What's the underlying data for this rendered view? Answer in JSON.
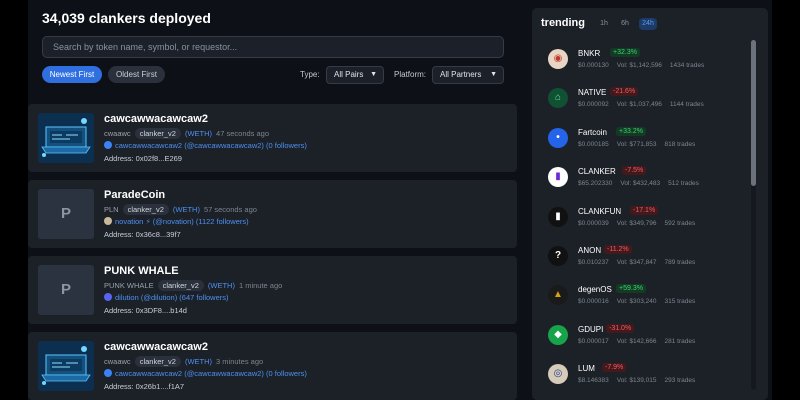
{
  "header": {
    "title": "34,039 clankers deployed"
  },
  "search": {
    "placeholder": "Search by token name, symbol, or requestor..."
  },
  "sort": {
    "newest": "Newest First",
    "oldest": "Oldest First"
  },
  "filters": {
    "type_label": "Type:",
    "type_value": "All Pairs",
    "platform_label": "Platform:",
    "platform_value": "All Partners"
  },
  "tokens": [
    {
      "name": "cawcawwacawcaw2",
      "symbol": "cwaawc",
      "badge": "clanker_v2",
      "pair": "(WETH)",
      "time": "47 seconds ago",
      "requestor": "cawcawwacawcaw2 (@cawcawwacawcaw2) (0 followers)",
      "address": "Address: 0x02f8...E269",
      "thumb": "art"
    },
    {
      "name": "ParadeCoin",
      "symbol": "PLN",
      "badge": "clanker_v2",
      "pair": "(WETH)",
      "time": "57 seconds ago",
      "requestor": "novation ⚡ (@novation) (1122 followers)",
      "address": "Address: 0x36c8...39f7",
      "thumb": "placeholder",
      "letter": "P"
    },
    {
      "name": "PUNK WHALE",
      "symbol": "PUNK WHALE",
      "badge": "clanker_v2",
      "pair": "(WETH)",
      "time": "1 minute ago",
      "requestor": "dilution (@dilution) (647 followers)",
      "address": "Address: 0x3DF8....b14d",
      "thumb": "placeholder",
      "letter": "P"
    },
    {
      "name": "cawcawwacawcaw2",
      "symbol": "cwaawc",
      "badge": "clanker_v2",
      "pair": "(WETH)",
      "time": "3 minutes ago",
      "requestor": "cawcawwacawcaw2 (@cawcawwacawcaw2) (0 followers)",
      "address": "Address: 0x26b1....f1A7",
      "thumb": "art"
    }
  ],
  "trending": {
    "title": "trending",
    "tabs": [
      "1h",
      "6h",
      "24h"
    ],
    "active_tab": "24h",
    "items": [
      {
        "name": "BNKR",
        "change": "+32.3%",
        "dir": "up",
        "price": "$0.000130",
        "vol": "Vol: $1,142,596",
        "trades": "1434 trades",
        "icon_bg": "#e8d5c4",
        "icon_fg": "#c0392b",
        "glyph": "◉"
      },
      {
        "name": "NATIVE",
        "change": "-21.6%",
        "dir": "down",
        "price": "$0.000092",
        "vol": "Vol: $1,037,496",
        "trades": "1144 trades",
        "icon_bg": "#0f5132",
        "icon_fg": "#6ee7a8",
        "glyph": "⌂"
      },
      {
        "name": "Fartcoin",
        "change": "+33.2%",
        "dir": "up",
        "price": "$0.000185",
        "vol": "Vol: $771,853",
        "trades": "818 trades",
        "icon_bg": "#2563eb",
        "icon_fg": "#ffffff",
        "glyph": "•"
      },
      {
        "name": "CLANKER",
        "change": "-7.5%",
        "dir": "down",
        "price": "$65.202330",
        "vol": "Vol: $432,483",
        "trades": "512 trades",
        "icon_bg": "#ffffff",
        "icon_fg": "#6d28d9",
        "glyph": "▮"
      },
      {
        "name": "CLANKFUN",
        "change": "-17.1%",
        "dir": "down",
        "price": "$0.000039",
        "vol": "Vol: $349,796",
        "trades": "592 trades",
        "icon_bg": "#111111",
        "icon_fg": "#ffffff",
        "glyph": "▮"
      },
      {
        "name": "ANON",
        "change": "-11.2%",
        "dir": "down",
        "price": "$0.010237",
        "vol": "Vol: $347,847",
        "trades": "789 trades",
        "icon_bg": "#111111",
        "icon_fg": "#ffffff",
        "glyph": "?"
      },
      {
        "name": "degenOS",
        "change": "+59.3%",
        "dir": "up",
        "price": "$0.000016",
        "vol": "Vol: $303,240",
        "trades": "315 trades",
        "icon_bg": "#1a1a1a",
        "icon_fg": "#d4a017",
        "glyph": "▲"
      },
      {
        "name": "GDUPI",
        "change": "-31.0%",
        "dir": "down",
        "price": "$0.000017",
        "vol": "Vol: $142,666",
        "trades": "281 trades",
        "icon_bg": "#16a34a",
        "icon_fg": "#ffffff",
        "glyph": "◆"
      },
      {
        "name": "LUM",
        "change": "-7.9%",
        "dir": "down",
        "price": "$8.146383",
        "vol": "Vol: $139,015",
        "trades": "293 trades",
        "icon_bg": "#d6cbb8",
        "icon_fg": "#1e3a8a",
        "glyph": "◎"
      }
    ]
  }
}
